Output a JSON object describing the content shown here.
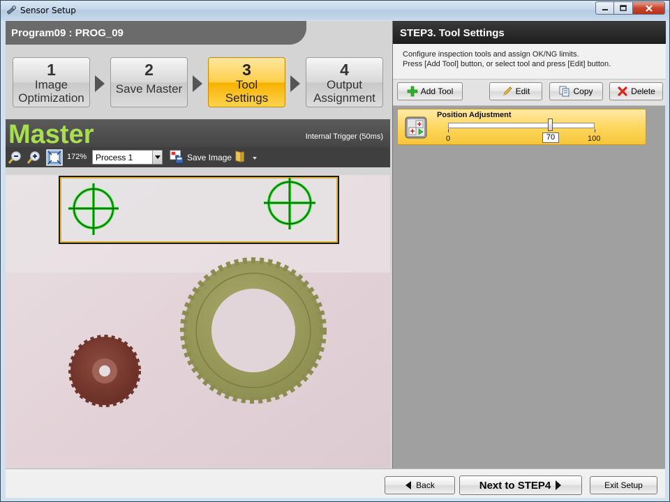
{
  "window": {
    "title": "Sensor Setup"
  },
  "program": {
    "title": "Program09 :  PROG_09"
  },
  "steps": [
    {
      "num": "1",
      "line1": "Image",
      "line2": "Optimization"
    },
    {
      "num": "2",
      "line1": "Save Master",
      "line2": ""
    },
    {
      "num": "3",
      "line1": "Tool",
      "line2": "Settings"
    },
    {
      "num": "4",
      "line1": "Output",
      "line2": "Assignment"
    }
  ],
  "active_step": 3,
  "master": {
    "title": "Master",
    "trigger": "Internal Trigger (50ms)"
  },
  "image_toolbar": {
    "zoom": "172%",
    "process": "Process 1",
    "save_image": "Save Image"
  },
  "right_panel": {
    "title": "STEP3. Tool Settings",
    "desc_line1": "Configure inspection tools and assign OK/NG limits.",
    "desc_line2": "Press [Add Tool] button, or select tool and press [Edit] button.",
    "buttons": {
      "add_tool": "Add Tool",
      "edit": "Edit",
      "copy": "Copy",
      "delete": "Delete"
    },
    "tool": {
      "name": "Position Adjustment",
      "min": "0",
      "max": "100",
      "value": "70",
      "value_fraction": 0.7
    }
  },
  "bottom": {
    "back": "Back",
    "next": "Next to STEP4",
    "exit": "Exit Setup"
  },
  "colors": {
    "active_step": "#ffce4a",
    "master_title": "#a7e04e",
    "target_marker": "#22e01e",
    "selection_box": "#d9a400"
  },
  "icons": {
    "app": "wrench-icon",
    "zoom_out": "zoom-out-icon",
    "zoom_in": "zoom-in-icon",
    "fit": "fit-to-window-icon",
    "save_image": "save-image-icon",
    "folder": "folder-icon",
    "add": "plus-icon",
    "edit": "pencil-icon",
    "copy": "copy-icon",
    "delete": "delete-x-icon",
    "back": "arrow-left-icon",
    "next": "arrow-right-icon"
  }
}
